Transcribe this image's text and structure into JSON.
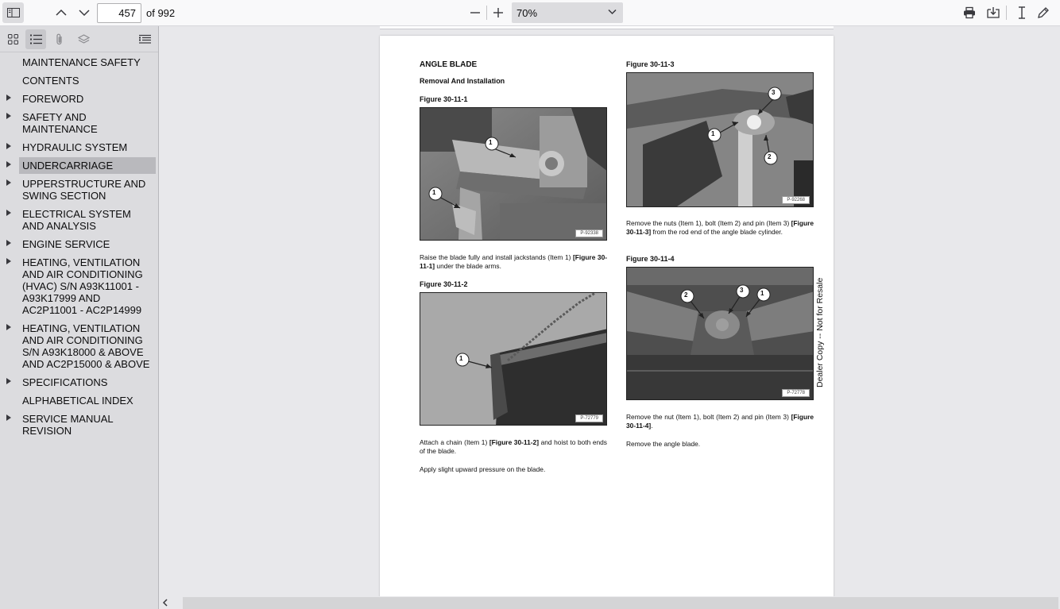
{
  "toolbar": {
    "page_number": "457",
    "page_count": "of 992",
    "zoom": "70%"
  },
  "outline": [
    {
      "label": "MAINTENANCE SAFETY",
      "expandable": false
    },
    {
      "label": "CONTENTS",
      "expandable": false
    },
    {
      "label": "FOREWORD",
      "expandable": true
    },
    {
      "label": "SAFETY AND MAINTENANCE",
      "expandable": true
    },
    {
      "label": "HYDRAULIC SYSTEM",
      "expandable": true
    },
    {
      "label": "UNDERCARRIAGE",
      "expandable": true,
      "selected": true
    },
    {
      "label": "UPPERSTRUCTURE AND SWING SECTION",
      "expandable": true
    },
    {
      "label": "ELECTRICAL SYSTEM AND ANALYSIS",
      "expandable": true
    },
    {
      "label": "ENGINE SERVICE",
      "expandable": true
    },
    {
      "label": "HEATING, VENTILATION AND AIR CONDITIONING (HVAC) S/N A93K11001 - A93K17999 AND AC2P11001 - AC2P14999",
      "expandable": true
    },
    {
      "label": "HEATING, VENTILATION AND AIR CONDITIONING S/N A93K18000 & ABOVE AND AC2P15000 & ABOVE",
      "expandable": true
    },
    {
      "label": "SPECIFICATIONS",
      "expandable": true
    },
    {
      "label": "ALPHABETICAL INDEX",
      "expandable": false
    },
    {
      "label": "SERVICE MANUAL REVISION",
      "expandable": true
    }
  ],
  "doc": {
    "title": "ANGLE BLADE",
    "subtitle": "Removal And Installation",
    "fig1": {
      "label": "Figure 30-11-1",
      "code": "P-92338"
    },
    "para1_a": "Raise the blade fully and install jackstands (Item 1) ",
    "para1_ref": "[Figure 30-11-1]",
    "para1_b": " under the blade arms.",
    "fig2": {
      "label": "Figure 30-11-2",
      "code": "P-72779"
    },
    "para2_a": "Attach a chain (Item 1) ",
    "para2_ref": "[Figure 30-11-2]",
    "para2_b": " and hoist to both ends of the blade.",
    "para3": "Apply slight upward pressure on the blade.",
    "fig3": {
      "label": "Figure 30-11-3",
      "code": "P-92268"
    },
    "para4_a": "Remove the nuts (Item 1), bolt (Item 2) and pin (Item 3) ",
    "para4_ref": "[Figure 30-11-3]",
    "para4_b": " from the rod end of the angle blade cylinder.",
    "fig4": {
      "label": "Figure 30-11-4",
      "code": "P-72778"
    },
    "para5_a": "Remove the nut (Item 1), bolt (Item 2) and pin (Item 3) ",
    "para5_ref": "[Figure 30-11-4]",
    "para5_b": ".",
    "para6": "Remove the angle blade.",
    "watermark": "Dealer Copy -- Not for Resale",
    "callouts": {
      "one": "1",
      "two": "2",
      "three": "3"
    }
  }
}
